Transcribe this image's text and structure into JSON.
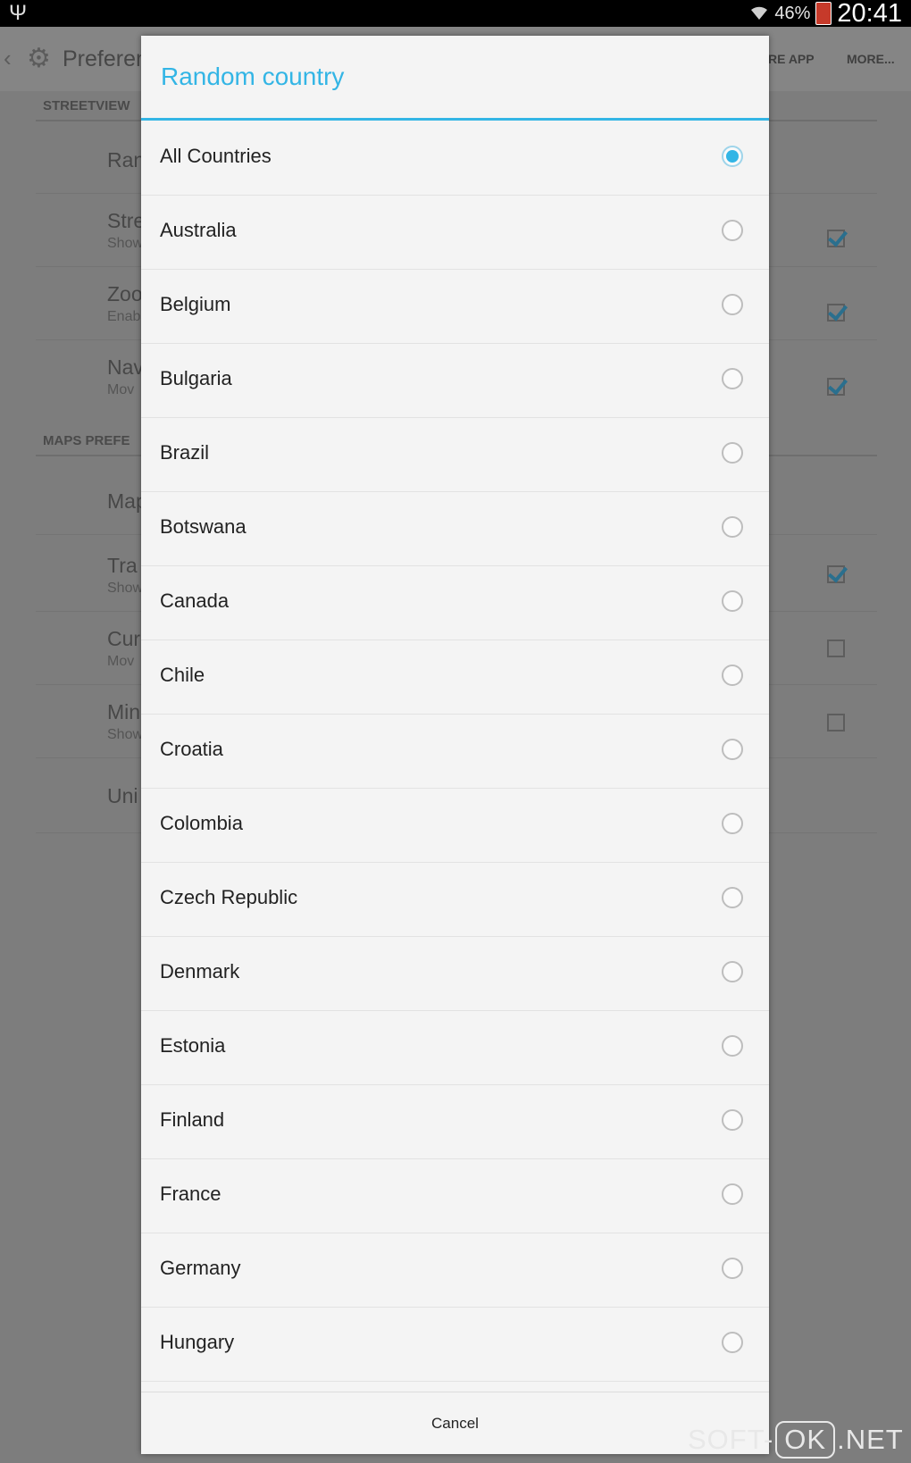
{
  "status_bar": {
    "battery_percent": "46%",
    "clock": "20:41",
    "icons": [
      "usb-icon",
      "wifi-icon",
      "battery-icon"
    ]
  },
  "background_screen": {
    "title": "Preferen",
    "actions": [
      "RE APP",
      "MORE..."
    ],
    "sections": {
      "streetview": "STREETVIEW",
      "maps": "MAPS PREFE"
    },
    "rows": [
      {
        "title": "Ran",
        "subtitle": "",
        "checkbox": null
      },
      {
        "title": "Stre",
        "subtitle": "Show",
        "checkbox": true
      },
      {
        "title": "Zoo",
        "subtitle": "Enab",
        "checkbox": true
      },
      {
        "title": "Nav",
        "subtitle": "Mov",
        "checkbox": true
      },
      {
        "title": "Map",
        "subtitle": "",
        "checkbox": null
      },
      {
        "title": "Tra",
        "subtitle": "Show",
        "checkbox": true
      },
      {
        "title": "Cur",
        "subtitle": "Mov",
        "checkbox": false
      },
      {
        "title": "Min",
        "subtitle": "Show",
        "checkbox": false
      },
      {
        "title": "Uni",
        "subtitle": "",
        "checkbox": null
      }
    ]
  },
  "dialog": {
    "title": "Random country",
    "accent_color": "#33b5e5",
    "selected": "All Countries",
    "options": [
      "All Countries",
      "Australia",
      "Belgium",
      "Bulgaria",
      "Brazil",
      "Botswana",
      "Canada",
      "Chile",
      "Croatia",
      "Colombia",
      "Czech Republic",
      "Denmark",
      "Estonia",
      "Finland",
      "France",
      "Germany",
      "Hungary"
    ],
    "cancel_label": "Cancel"
  },
  "watermark": {
    "left": "SOFT-",
    "mid": "OK",
    "right": ".NET"
  }
}
